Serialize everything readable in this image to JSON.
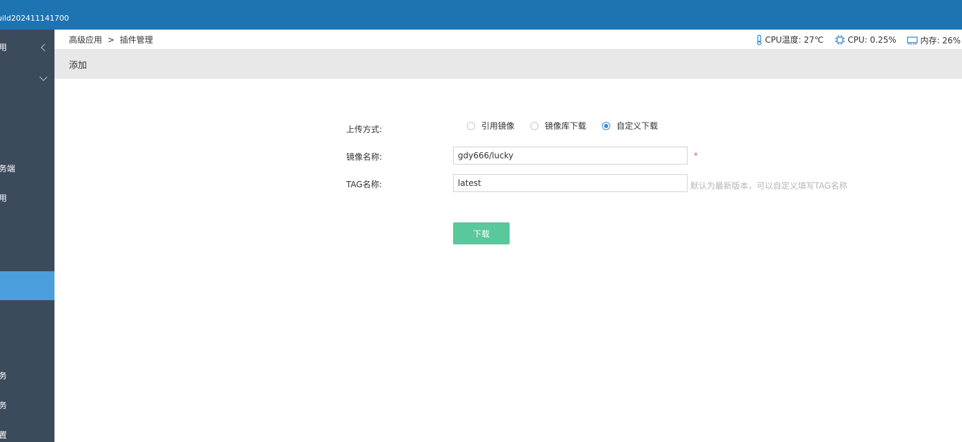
{
  "topbar": {
    "build": "uild202411141700"
  },
  "sidebar": {
    "items": [
      {
        "label": "用"
      },
      {
        "label": "务端"
      },
      {
        "label": "用"
      },
      {
        "label": "务"
      },
      {
        "label": "务"
      },
      {
        "label": "置"
      }
    ]
  },
  "breadcrumb": {
    "parent": "高级应用",
    "separator": ">",
    "current": "插件管理"
  },
  "stats": {
    "cpu_temp": "CPU温度: 27℃",
    "cpu": "CPU: 0.25%",
    "memory": "内存: 26%"
  },
  "subheader": {
    "title": "添加"
  },
  "form": {
    "upload_label": "上传方式:",
    "upload_options": [
      "引用镜像",
      "镜像库下载",
      "自定义下载"
    ],
    "upload_selected": "自定义下载",
    "image_label": "镜像名称:",
    "image_value": "gdy666/lucky",
    "required_mark": "*",
    "tag_label": "TAG名称:",
    "tag_value": "latest",
    "tag_hint": "默认为最新版本，可以自定义填写TAG名称",
    "download_button": "下载"
  },
  "colors": {
    "topbar": "#1e74b3",
    "sidebar": "#3c4b5c",
    "active": "#4a9fdc",
    "button": "#5ac79c"
  }
}
